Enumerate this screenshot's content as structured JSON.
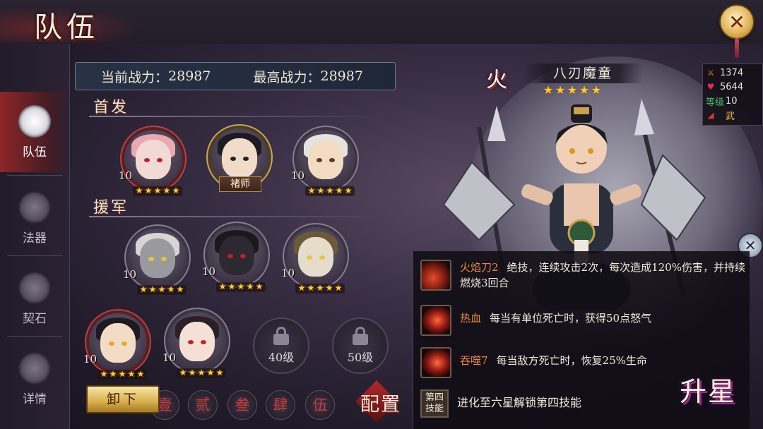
{
  "header": {
    "title": "队伍",
    "close_symbol": "✕"
  },
  "nav": {
    "items": [
      {
        "label": "队伍",
        "icon": "team-icon",
        "active": true
      },
      {
        "label": "法器",
        "icon": "artifact-icon",
        "active": false
      },
      {
        "label": "契石",
        "icon": "contract-stone-icon",
        "active": false
      },
      {
        "label": "详情",
        "icon": "detail-icon",
        "active": false
      }
    ]
  },
  "power": {
    "current_label": "当前战力：",
    "current_value": "28987",
    "max_label": "最高战力：",
    "max_value": "28987"
  },
  "sections": {
    "starting": "首发",
    "support": "援军"
  },
  "starting": [
    {
      "level": "10",
      "stars": 5
    },
    {
      "level": "",
      "name": "褚师",
      "stars": 0
    },
    {
      "level": "10",
      "stars": 5
    }
  ],
  "support": [
    {
      "level": "10",
      "stars": 5
    },
    {
      "level": "10",
      "stars": 5
    },
    {
      "level": "10",
      "stars": 5
    },
    {
      "level": "10",
      "stars": 5
    },
    {
      "level": "10",
      "stars": 5
    }
  ],
  "locked": [
    {
      "label": "40级"
    },
    {
      "label": "50级"
    }
  ],
  "bottom": {
    "unload": "卸下",
    "tabs": [
      "壹",
      "贰",
      "叁",
      "肆",
      "伍"
    ],
    "config": "配置"
  },
  "hero": {
    "element": "火",
    "name": "八刃魔童",
    "stars": 5,
    "stats": {
      "attack": "1374",
      "hp": "5644",
      "level_label": "等级",
      "level": "10",
      "type": "武"
    },
    "close_symbol": "✕"
  },
  "skills": [
    {
      "name": "火焰刀2",
      "desc": "绝技，连续攻击2次，每次造成120%伤害，并持续燃烧3回合"
    },
    {
      "name": "热血",
      "desc": "每当有单位死亡时，获得50点怒气"
    },
    {
      "name": "吞噬7",
      "desc": "每当敌方死亡时，恢复25%生命"
    },
    {
      "name": "第四技能",
      "desc": "进化至六星解锁第四技能"
    }
  ],
  "starup": "升星",
  "colors": {
    "accent_red": "#b12a2a",
    "gold": "#d9ae4b",
    "star": "#ffcc33",
    "skill_name": "#e88a3a"
  }
}
